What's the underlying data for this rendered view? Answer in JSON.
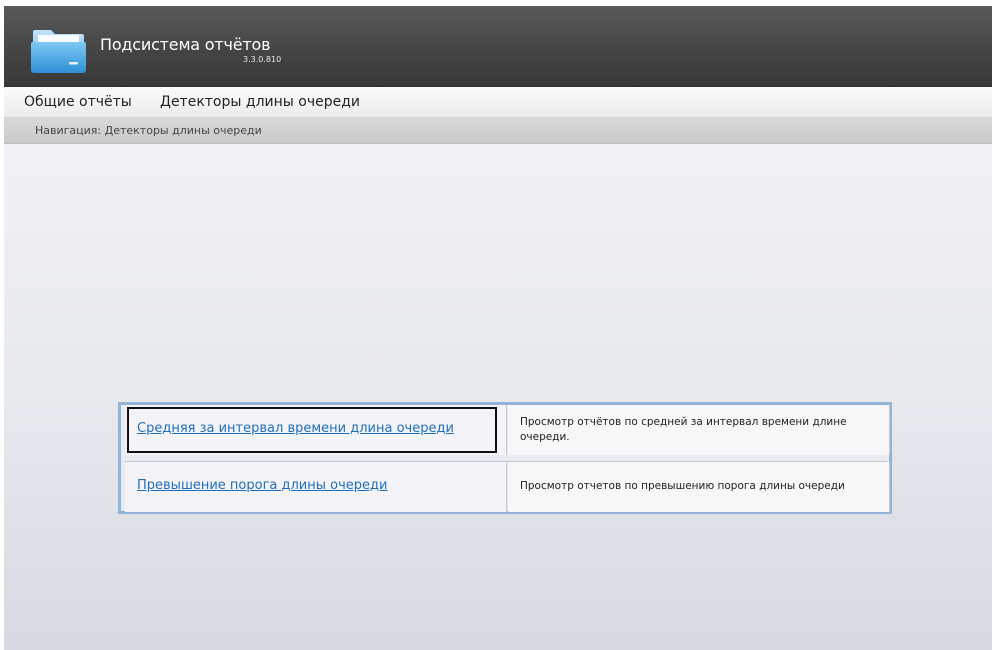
{
  "app": {
    "title": "Подсистема отчётов",
    "version": "3.3.0.810",
    "icon": "folder-icon"
  },
  "menu": {
    "items": [
      {
        "label": "Общие отчёты"
      },
      {
        "label": "Детекторы длины очереди"
      }
    ]
  },
  "navigation": {
    "text": "Навигация: Детекторы длины очереди"
  },
  "reports": [
    {
      "title": "Средняя за интервал времени длина очереди",
      "description": "Просмотр отчётов по средней за интервал времени длине очереди."
    },
    {
      "title": "Превышение порога длины очереди",
      "description": "Просмотр отчетов по превышению порога длины очереди"
    }
  ],
  "colors": {
    "header_bg": "#454545",
    "link": "#1f6fb8",
    "table_border": "#93b3d9"
  }
}
